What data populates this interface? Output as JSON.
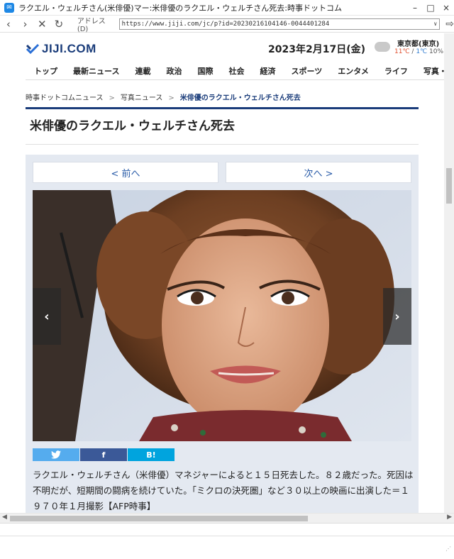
{
  "window": {
    "title": "ラクエル・ウェルチさん(米俳優)マー:米俳優のラクエル・ウェルチさん死去:時事ドットコム",
    "controls": {
      "minimize": "–",
      "maximize": "□",
      "close": "×"
    }
  },
  "addressbar": {
    "label": "アドレス(D)",
    "url": "https://www.jiji.com/jc/p?id=20230216104146-0044401284"
  },
  "site": {
    "logo": "JIJI.COM",
    "date": "2023年2月17日(金)",
    "weather": {
      "city": "東京都(東京)",
      "high": "11℃",
      "sep": " / ",
      "low": "1℃",
      "chance": " 10%"
    }
  },
  "gnav": [
    "トップ",
    "最新ニュース",
    "連載",
    "政治",
    "国際",
    "社会",
    "経済",
    "スポーツ",
    "エンタメ",
    "ライフ",
    "写真・動"
  ],
  "breadcrumb": {
    "home": "時事ドットコムニュース",
    "sep": ">",
    "photo": "写真ニュース",
    "current": "米俳優のラクエル・ウェルチさん死去"
  },
  "article": {
    "title": "米俳優のラクエル・ウェルチさん死去",
    "prev": "< 前へ",
    "next": "次へ >",
    "share": {
      "twitter": "twitter-bird",
      "facebook": "f",
      "hatena": "B!"
    },
    "caption": "ラクエル・ウェルチさん（米俳優）マネジャーによると１５日死去した。８２歳だった。死因は不明だが、短期間の闘病を続けていた。「ミクロの決死圏」など３０以上の映画に出演した＝１９７０年１月撮影【AFP時事】"
  },
  "colors": {
    "brand": "#1a3c7a",
    "panel": "#e4e9f1",
    "twitter": "#55acee",
    "facebook": "#3b5998",
    "hatena": "#00a4de"
  }
}
